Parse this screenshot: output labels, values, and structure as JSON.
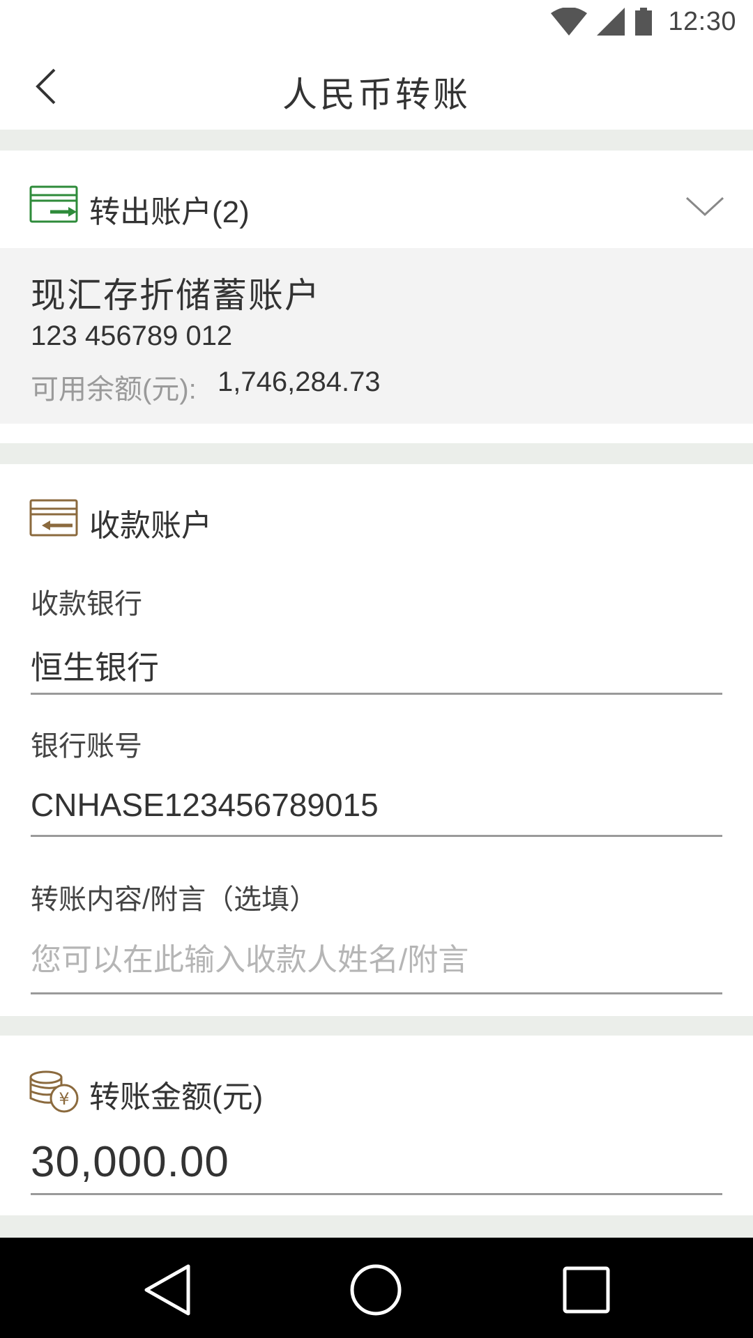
{
  "status_bar": {
    "time": "12:30"
  },
  "header": {
    "title": "人民币转账"
  },
  "from_account": {
    "title": "转出账户(2)",
    "account_name": "现汇存折储蓄账户",
    "account_number": "123 456789 012",
    "balance_label": "可用余额(元):",
    "balance_value": "1,746,284.73"
  },
  "payee": {
    "title": "收款账户",
    "bank_label": "收款银行",
    "bank_value": "恒生银行",
    "account_label": "银行账号",
    "account_value": "CNHASE123456789015",
    "memo_label": "转账内容/附言（选填）",
    "memo_placeholder": "您可以在此输入收款人姓名/附言"
  },
  "amount": {
    "title": "转账金额(元)",
    "value": "30,000.00"
  },
  "colors": {
    "accent_green": "#2e8b3a",
    "accent_brown": "#8b6a3e",
    "divider": "#ebeeea",
    "account_box": "#f3f3f3"
  },
  "icons": {
    "status": [
      "wifi-icon",
      "signal-icon",
      "battery-icon"
    ],
    "back": "back-arrow-icon",
    "from_account": "card-transfer-out-icon",
    "expand": "chevron-down-icon",
    "payee": "card-transfer-in-icon",
    "amount": "coins-yuan-icon",
    "nav": [
      "nav-back-icon",
      "nav-home-icon",
      "nav-recents-icon"
    ]
  }
}
